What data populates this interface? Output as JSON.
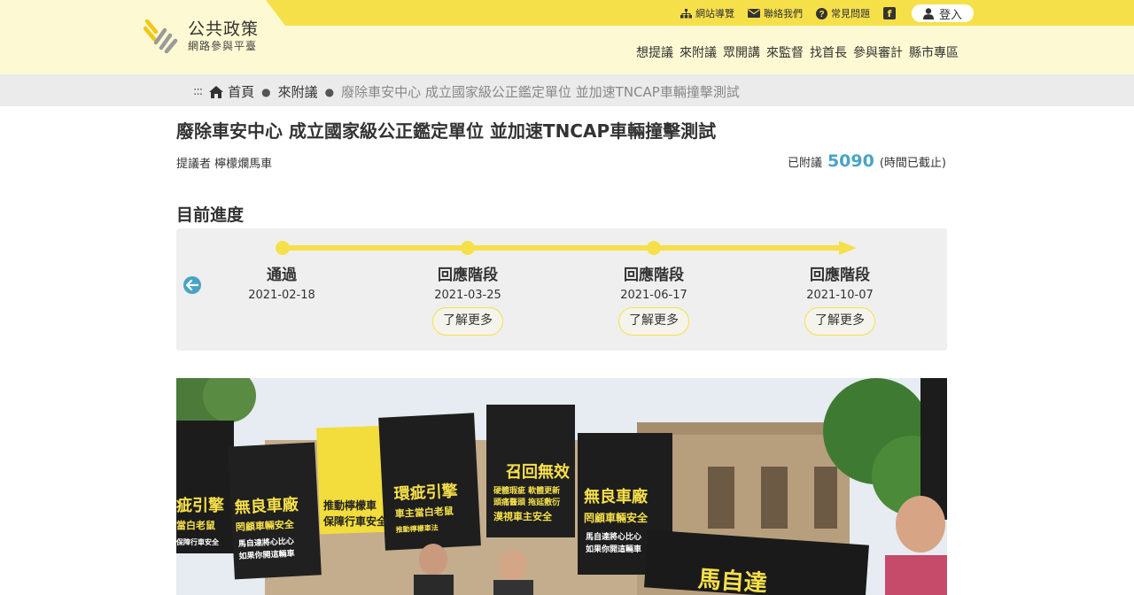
{
  "header": {
    "logo_title": "公共政策",
    "logo_subtitle": "網路參與平臺",
    "top_links": [
      {
        "label": "網站導覽",
        "icon": "sitemap-icon"
      },
      {
        "label": "聯絡我們",
        "icon": "mail-icon"
      },
      {
        "label": "常見問題",
        "icon": "question-icon"
      }
    ],
    "facebook_icon": "facebook-icon",
    "login_label": "登入",
    "nav": [
      "想提議",
      "來附議",
      "眾開講",
      "來監督",
      "找首長",
      "參與審計",
      "縣市專區"
    ],
    "colors": {
      "accent": "#f6e04a",
      "header_bg": "#fdf9d2"
    }
  },
  "breadcrumb": {
    "home": "首頁",
    "section": "來附議",
    "current": "廢除車安中心 成立國家級公正鑑定單位 並加速TNCAP車輛撞擊測試"
  },
  "proposal": {
    "title": "廢除車安中心 成立國家級公正鑑定單位 並加速TNCAP車輛撞擊測試",
    "proposer_label": "提議者",
    "proposer_name": "檸檬爛馬車",
    "signed_label": "已附議",
    "signed_count": "5090",
    "status": "(時間已截止)",
    "count_color": "#4aa3c7"
  },
  "progress": {
    "heading": "目前進度",
    "stages": [
      {
        "name": "通過",
        "date": "2021-02-18",
        "more": ""
      },
      {
        "name": "回應階段",
        "date": "2021-03-25",
        "more": "了解更多"
      },
      {
        "name": "回應階段",
        "date": "2021-06-17",
        "more": "了解更多"
      },
      {
        "name": "回應階段",
        "date": "2021-10-07",
        "more": "了解更多"
      }
    ]
  },
  "photo": {
    "signs": [
      {
        "lines": [
          "召回無效",
          "硬體瑕疵 軟體更新",
          "頭痛醫頭 拖延敷衍",
          "漠視車主安全"
        ]
      },
      {
        "lines": [
          "環疵引擎",
          "車主當白老鼠",
          "推動檸檬車法"
        ]
      },
      {
        "lines": [
          "無良車廠",
          "罔顧車輛安全",
          "馬自達將心比心",
          "如果你開這輛車"
        ]
      },
      {
        "lines": [
          "推動檸檬車",
          "保障行車安全"
        ]
      },
      {
        "lines": [
          "無良車廠",
          "罔顧車輛安全",
          "馬自達將心比心",
          "如果你開這輛車"
        ]
      },
      {
        "lines": [
          "疵引擎",
          "當白老鼠",
          "保障行車安全"
        ]
      },
      {
        "lines": [
          "馬自達"
        ]
      }
    ]
  }
}
